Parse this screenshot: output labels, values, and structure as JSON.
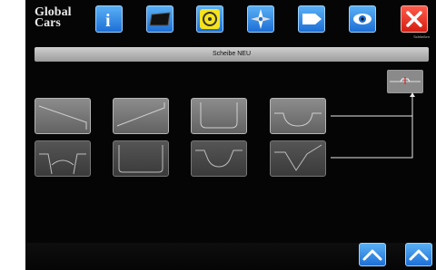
{
  "logo": {
    "line1": "Global",
    "line2": "Cars"
  },
  "toolbar": {
    "buttons": [
      {
        "icon": "info-icon"
      },
      {
        "icon": "blade-icon"
      },
      {
        "icon": "circle-icon"
      },
      {
        "icon": "compass-icon"
      },
      {
        "icon": "next-icon"
      },
      {
        "icon": "eye-icon"
      },
      {
        "icon": "close-icon"
      }
    ],
    "close_caption": "Schließen"
  },
  "title": "Scheibe NEU",
  "shapes": [
    {
      "name": "shape-slope-down"
    },
    {
      "name": "shape-slope-up"
    },
    {
      "name": "shape-u-narrow"
    },
    {
      "name": "shape-u-wide"
    },
    {
      "name": "shape-arch"
    },
    {
      "name": "shape-rounded-rect"
    },
    {
      "name": "shape-notch-trapezoid"
    },
    {
      "name": "shape-v-notch"
    }
  ],
  "colors": {
    "accent": "#1d6fd6",
    "close": "#d51e12",
    "background": "#050505"
  }
}
